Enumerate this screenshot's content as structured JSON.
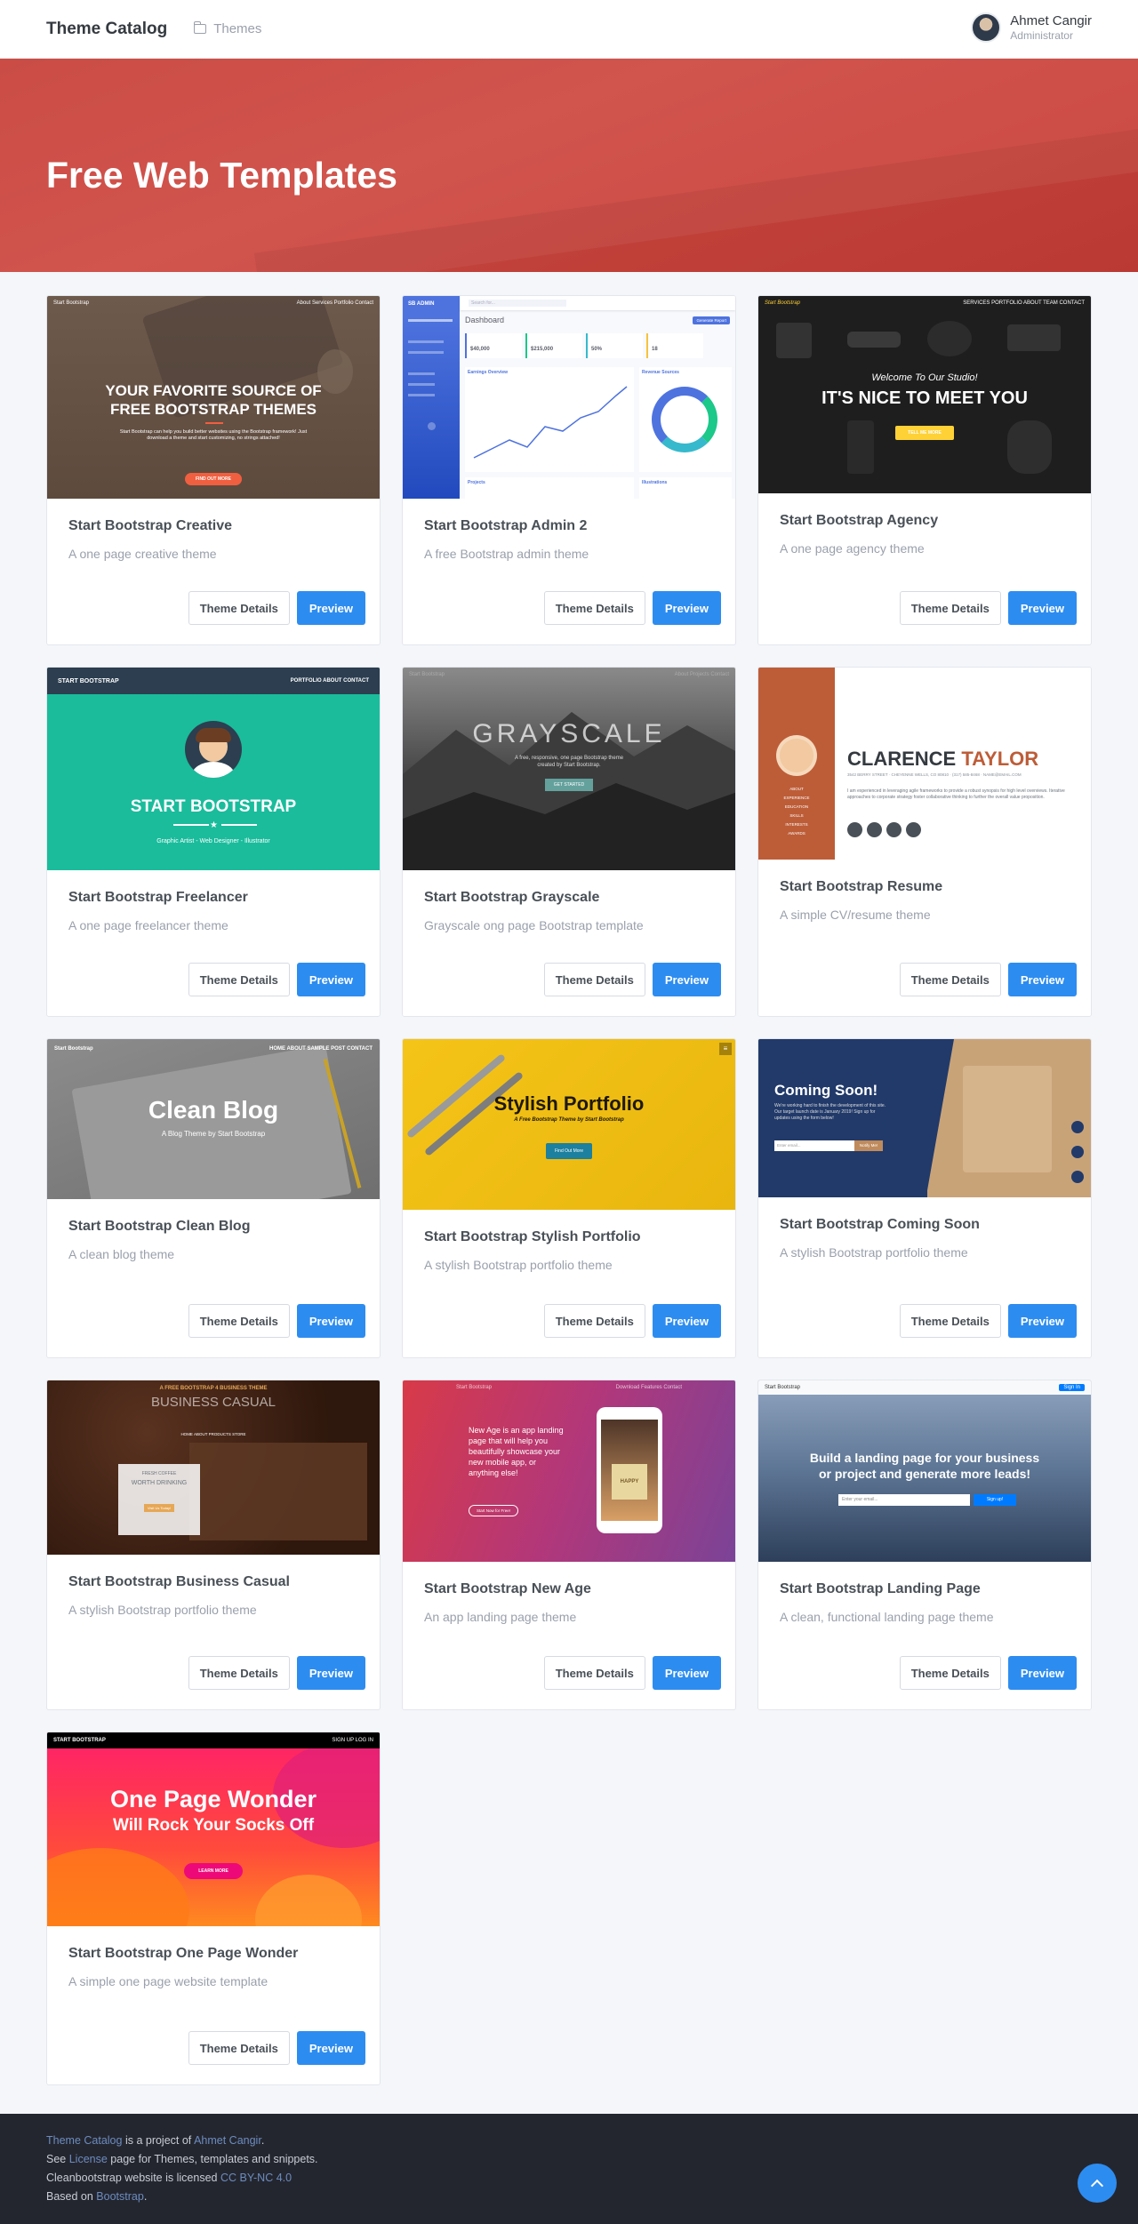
{
  "header": {
    "brand": "Theme Catalog",
    "breadcrumb": "Themes",
    "user_name": "Ahmet Cangir",
    "user_role": "Administrator"
  },
  "hero": {
    "title": "Free Web Templates"
  },
  "buttons": {
    "details": "Theme Details",
    "preview": "Preview"
  },
  "cards": [
    {
      "title": "Start Bootstrap Creative",
      "desc": "A one page creative theme",
      "thumb": {
        "brand": "Start Bootstrap",
        "nav": "About   Services   Portfolio   Contact",
        "headline1": "YOUR FAVORITE SOURCE OF",
        "headline2": "FREE BOOTSTRAP THEMES",
        "sub": "Start Bootstrap can help you build better websites using the Bootstrap framework! Just download a theme and start customizing, no strings attached!",
        "cta": "FIND OUT MORE"
      }
    },
    {
      "title": "Start Bootstrap Admin 2",
      "desc": "A free Bootstrap admin theme",
      "thumb": {
        "brand": "SB ADMIN",
        "page": "Dashboard",
        "search": "Search for...",
        "report": "Generate Report",
        "kpi1": "$40,000",
        "kpi2": "$215,000",
        "kpi3": "50%",
        "kpi4": "18",
        "chart1": "Earnings Overview",
        "chart2": "Revenue Sources",
        "row1": "Projects",
        "row2": "Illustrations"
      }
    },
    {
      "title": "Start Bootstrap Agency",
      "desc": "A one page agency theme",
      "thumb": {
        "brand": "Start Bootstrap",
        "nav": "SERVICES   PORTFOLIO   ABOUT   TEAM   CONTACT",
        "sub": "Welcome To Our Studio!",
        "headline": "IT'S NICE TO MEET YOU",
        "cta": "TELL ME MORE"
      }
    },
    {
      "title": "Start Bootstrap Freelancer",
      "desc": "A one page freelancer theme",
      "thumb": {
        "brand": "START BOOTSTRAP",
        "nav": "PORTFOLIO   ABOUT   CONTACT",
        "headline": "START BOOTSTRAP",
        "sub": "Graphic Artist - Web Designer - Illustrator"
      }
    },
    {
      "title": "Start Bootstrap Grayscale",
      "desc": "Grayscale ong page Bootstrap template",
      "thumb": {
        "brand": "Start Bootstrap",
        "nav": "About   Projects   Contact",
        "headline": "GRAYSCALE",
        "sub": "A free, responsive, one page Bootstrap theme created by Start Bootstrap.",
        "cta": "GET STARTED"
      }
    },
    {
      "title": "Start Bootstrap Resume",
      "desc": "A simple CV/resume theme",
      "thumb": {
        "first": "CLARENCE",
        "last": "TAYLOR",
        "contact": "3542 BERRY STREET · CHEYENNE WELLS, CO 80810 · (317) 585-8468 · NAME@EMAIL.COM",
        "body": "I am experienced in leveraging agile frameworks to provide a robust synopsis for high level overviews. Iterative approaches to corporate strategy foster collaborative thinking to further the overall value proposition.",
        "menu": [
          "ABOUT",
          "EXPERIENCE",
          "EDUCATION",
          "SKILLS",
          "INTERESTS",
          "AWARDS"
        ]
      }
    },
    {
      "title": "Start Bootstrap Clean Blog",
      "desc": "A clean blog theme",
      "thumb": {
        "brand": "Start Bootstrap",
        "nav": "HOME   ABOUT   SAMPLE POST   CONTACT",
        "headline": "Clean Blog",
        "sub": "A Blog Theme by Start Bootstrap"
      }
    },
    {
      "title": "Start Bootstrap Stylish Portfolio",
      "desc": "A stylish Bootstrap portfolio theme",
      "thumb": {
        "headline": "Stylish Portfolio",
        "sub": "A Free Bootstrap Theme by Start Bootstrap",
        "cta": "Find Out More"
      }
    },
    {
      "title": "Start Bootstrap Coming Soon",
      "desc": "A stylish Bootstrap portfolio theme",
      "thumb": {
        "headline": "Coming Soon!",
        "sub": "We're working hard to finish the development of this site. Our target launch date is January 2019! Sign up for updates using the form below!",
        "placeholder": "Enter email...",
        "cta": "Notify Me!"
      }
    },
    {
      "title": "Start Bootstrap Business Casual",
      "desc": "A stylish Bootstrap portfolio theme",
      "thumb": {
        "top": "A FREE BOOTSTRAP 4 BUSINESS THEME",
        "headline": "BUSINESS CASUAL",
        "nav": "HOME   ABOUT   PRODUCTS   STORE",
        "box1": "FRESH COFFEE",
        "box2": "WORTH DRINKING",
        "cta": "Visit Us Today!"
      }
    },
    {
      "title": "Start Bootstrap New Age",
      "desc": "An app landing page theme",
      "thumb": {
        "brand": "Start Bootstrap",
        "nav": "Download   Features   Contact",
        "headline": "New Age is an app landing page that will help you beautifully showcase your new mobile app, or anything else!",
        "cta": "Start Now for Free!",
        "phone": "HAPPY"
      }
    },
    {
      "title": "Start Bootstrap Landing Page",
      "desc": "A clean, functional landing page theme",
      "thumb": {
        "brand": "Start Bootstrap",
        "signin": "Sign In",
        "headline": "Build a landing page for your business or project and generate more leads!",
        "placeholder": "Enter your email...",
        "cta": "Sign up!"
      }
    },
    {
      "title": "Start Bootstrap One Page Wonder",
      "desc": "A simple one page website template",
      "thumb": {
        "brand": "START BOOTSTRAP",
        "nav": "SIGN UP   LOG IN",
        "headline1": "One Page Wonder",
        "headline2": "Will Rock Your Socks Off",
        "cta": "LEARN MORE"
      }
    }
  ],
  "footer": {
    "line1_link1": "Theme Catalog",
    "line1_text": " is a project of ",
    "line1_link2": "Ahmet Cangir",
    "line1_end": ".",
    "line2_pre": "See ",
    "line2_link": "License",
    "line2_post": " page for Themes, templates and snippets.",
    "line3_pre": "Cleanbootstrap website is licensed ",
    "line3_link": "CC BY-NC 4.0",
    "line4_pre": "Based on ",
    "line4_link": "Bootstrap",
    "line4_end": "."
  },
  "colors": {
    "hero": "#c7413a",
    "primary": "#2d8cf0",
    "footer": "#24262f"
  }
}
